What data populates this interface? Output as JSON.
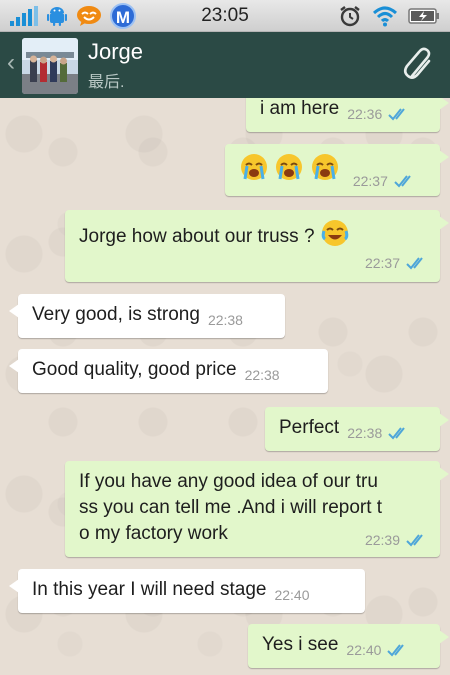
{
  "status_bar": {
    "time": "23:05",
    "icons": [
      "signal-bars-icon",
      "android-icon",
      "chat-face-icon",
      "m-app-icon",
      "alarm-icon",
      "wifi-icon",
      "battery-icon"
    ]
  },
  "header": {
    "contact_name": "Jorge",
    "contact_status": "最后.",
    "back_icon": "chevron-left-icon",
    "attach_icon": "paperclip-icon"
  },
  "colors": {
    "header_bg": "#2b4a45",
    "outgoing_bubble": "#e2f7cb",
    "incoming_bubble": "#ffffff",
    "read_ticks": "#4fa6d9"
  },
  "messages": [
    {
      "direction": "out",
      "text": "i am here",
      "time": "22:36"
    },
    {
      "direction": "out",
      "text": "",
      "emoji": [
        "crying-face",
        "crying-face",
        "crying-face"
      ],
      "time": "22:37"
    },
    {
      "direction": "out",
      "text": "Jorge how about our truss ?",
      "emoji": [
        "tears-of-joy-face"
      ],
      "time": "22:37"
    },
    {
      "direction": "in",
      "text": "Very good, is strong",
      "time": "22:38"
    },
    {
      "direction": "in",
      "text": "Good quality, good price",
      "time": "22:38"
    },
    {
      "direction": "out",
      "text": "Perfect",
      "time": "22:38"
    },
    {
      "direction": "out",
      "text": "If you have any good idea of our truss you can tell me .And i will report to my factory work",
      "lines": [
        "If you have any good idea of our tru",
        "ss you can tell me .And i will report t",
        "o my factory work"
      ],
      "time": "22:39"
    },
    {
      "direction": "in",
      "text": "In this year I will need stage",
      "time": "22:40"
    },
    {
      "direction": "out",
      "text": "Yes i see",
      "time": "22:40"
    }
  ]
}
